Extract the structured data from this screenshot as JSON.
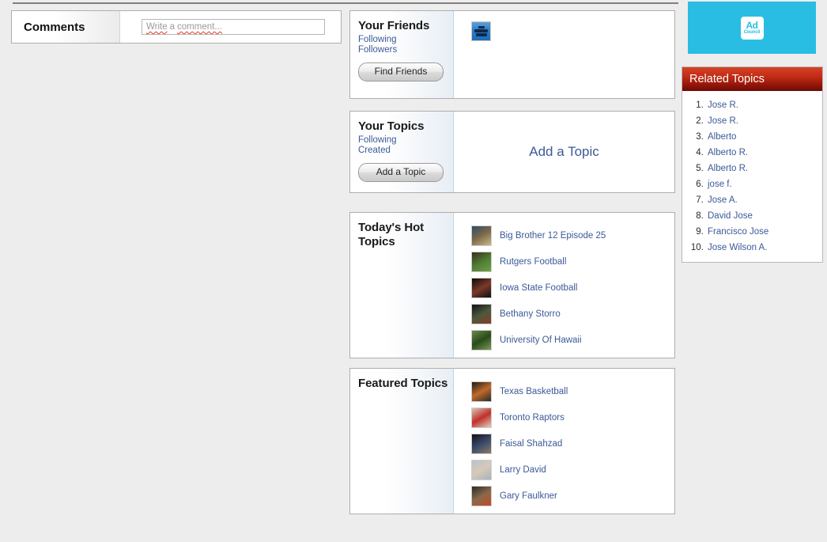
{
  "comments": {
    "label": "Comments",
    "input_value": "",
    "placeholder_word1": "Write",
    "placeholder_word2": "a",
    "placeholder_word3": "comment...",
    "placeholder": "Write a comment..."
  },
  "friends": {
    "title": "Your Friends",
    "links": [
      {
        "label": "Following"
      },
      {
        "label": "Followers"
      }
    ],
    "button_label": "Find Friends",
    "avatars": [
      {
        "alt": "friend-thumbnail"
      }
    ]
  },
  "your_topics": {
    "title": "Your Topics",
    "links": [
      {
        "label": "Following"
      },
      {
        "label": "Created"
      }
    ],
    "button_label": "Add a Topic",
    "empty_cta": "Add a Topic"
  },
  "hot_topics": {
    "title": "Today's Hot Topics",
    "items": [
      {
        "label": "Big Brother  12 Episode  25",
        "thumb": "bigbrother-thumb",
        "c1": "#2e4a66",
        "c2": "#7e6a4a",
        "c3": "#c9b88a"
      },
      {
        "label": "Rutgers Football",
        "thumb": "rutgers-thumb",
        "c1": "#3a2a1c",
        "c2": "#4f7c33",
        "c3": "#6fa04a"
      },
      {
        "label": "Iowa State Football",
        "thumb": "iowastate-thumb",
        "c1": "#0a0a0a",
        "c2": "#7a3a2a",
        "c3": "#101010"
      },
      {
        "label": "Bethany Storro",
        "thumb": "bethany-thumb",
        "c1": "#101018",
        "c2": "#4a5a3a",
        "c3": "#8a3a2a"
      },
      {
        "label": "University Of Hawaii",
        "thumb": "hawaii-thumb",
        "c1": "#6a8a4a",
        "c2": "#2a4a1a",
        "c3": "#7a9a5a"
      }
    ]
  },
  "featured_topics": {
    "title": "Featured Topics",
    "items": [
      {
        "label": "Texas Basketball",
        "thumb": "texas-thumb",
        "c1": "#1a1a1a",
        "c2": "#c06a2a",
        "c3": "#2a2a2a"
      },
      {
        "label": "Toronto Raptors",
        "thumb": "raptors-thumb",
        "c1": "#d8c8b8",
        "c2": "#c0302a",
        "c3": "#e0d0c0"
      },
      {
        "label": "Faisal Shahzad",
        "thumb": "faisal-thumb",
        "c1": "#101018",
        "c2": "#3a4a6a",
        "c3": "#8a7a6a"
      },
      {
        "label": "Larry David",
        "thumb": "larrydavid-thumb",
        "c1": "#b8c4cc",
        "c2": "#d8c8b8",
        "c3": "#a8b4bc"
      },
      {
        "label": "Gary Faulkner",
        "thumb": "gary-thumb",
        "c1": "#2a2a2a",
        "c2": "#8a6a4a",
        "c3": "#c04a2a"
      }
    ]
  },
  "ad": {
    "logo_line1": "Ad",
    "logo_line2": "Council",
    "bg_color": "#29bde4"
  },
  "related_topics": {
    "header": "Related Topics",
    "header_color": "#c02a14",
    "items": [
      {
        "label": "Jose R."
      },
      {
        "label": "Jose R."
      },
      {
        "label": "Alberto"
      },
      {
        "label": "Alberto R."
      },
      {
        "label": "Alberto R."
      },
      {
        "label": "jose f."
      },
      {
        "label": "Jose A."
      },
      {
        "label": "David Jose"
      },
      {
        "label": "Francisco Jose"
      },
      {
        "label": "Jose Wilson A."
      }
    ]
  }
}
